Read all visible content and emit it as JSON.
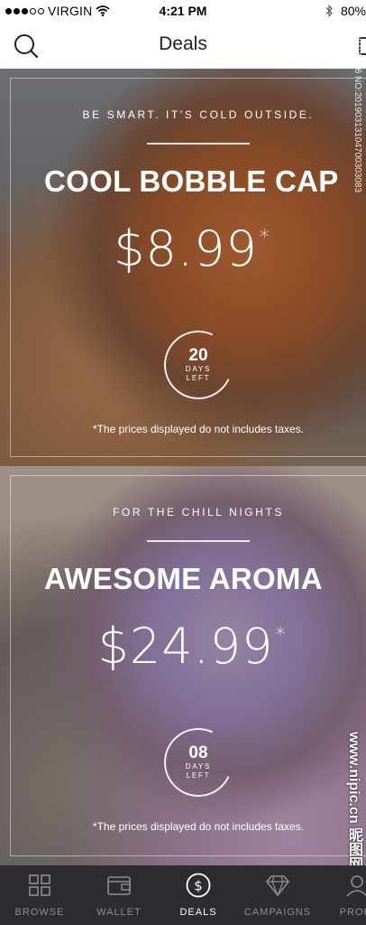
{
  "status_bar": {
    "carrier": "VIRGIN",
    "time": "4:21 PM",
    "battery": "80%"
  },
  "nav": {
    "title": "Deals"
  },
  "deals": [
    {
      "tagline": "BE SMART. IT'S COLD OUTSIDE.",
      "title": "COOL BOBBLE CAP",
      "price": "$8.99",
      "price_mark": "*",
      "days_left": "20",
      "days_label_1": "DAYS",
      "days_label_2": "LEFT",
      "disclaimer": "*The prices displayed do not includes taxes."
    },
    {
      "tagline": "FOR THE CHILL NIGHTS",
      "title": "AWESOME AROMA",
      "price": "$24.99",
      "price_mark": "*",
      "days_left": "08",
      "days_label_1": "DAYS",
      "days_label_2": "LEFT",
      "disclaimer": "*The prices displayed do not includes taxes."
    }
  ],
  "watermark": {
    "id_text": "ID:28408416 NO:20190313104700303083",
    "site_text": "www.nipic.cn 昵图网"
  },
  "tabs": [
    {
      "label": "BROWSE",
      "icon": "grid-icon",
      "active": false
    },
    {
      "label": "WALLET",
      "icon": "wallet-icon",
      "active": false
    },
    {
      "label": "DEALS",
      "icon": "dollar-icon",
      "active": true
    },
    {
      "label": "CAMPAIGNS",
      "icon": "diamond-icon",
      "active": false
    },
    {
      "label": "PROFI",
      "icon": "profile-icon",
      "active": false
    }
  ],
  "colors": {
    "tab_bar_bg": "#2b2d30",
    "tab_inactive": "#8b8e93",
    "tab_active": "#ffffff"
  }
}
